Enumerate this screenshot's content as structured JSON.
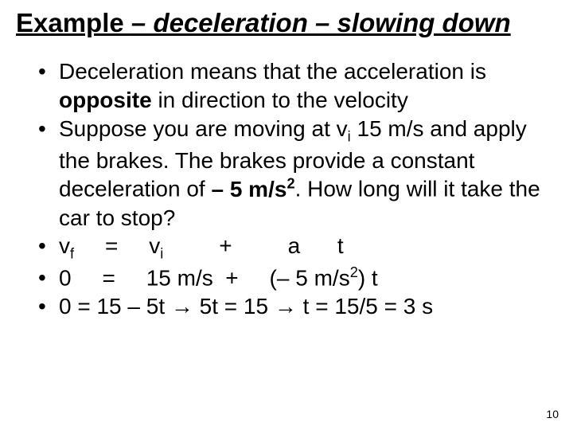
{
  "title": {
    "seg1": "Example ",
    "seg2": "– deceleration – ",
    "seg3": "slowing down"
  },
  "bullets": {
    "b1_a": "Deceleration means that the acceleration is ",
    "b1_b": "opposite",
    "b1_c": " in direction to the velocity",
    "b2_a": "Suppose you are moving at v",
    "b2_sub": "i",
    "b2_b": " 15 m/s and apply the brakes. The brakes provide a constant deceleration of ",
    "b2_minus": "–",
    "b2_c": " 5 m/s",
    "b2_sup": "2",
    "b2_d": ". How long will it take the car to stop?",
    "b3_vf_v": "v",
    "b3_vf_sub": "f",
    "b3_eq": "     =     ",
    "b3_vi_v": "v",
    "b3_vi_sub": "i",
    "b3_plus": "         +         ",
    "b3_a": "a",
    "b3_sp": "      ",
    "b3_t": "t",
    "b4_a": "0     =     15 m/s  +     (",
    "b4_minus": "–",
    "b4_b": " 5 m/s",
    "b4_sup": "2",
    "b4_c": ") t",
    "b5_a": "0 = 15 – 5t ",
    "b5_arrow1": "→",
    "b5_b": " 5t = 15 ",
    "b5_arrow2": "→",
    "b5_c": "  t = 15/5 = 3 s"
  },
  "page_number": "10"
}
